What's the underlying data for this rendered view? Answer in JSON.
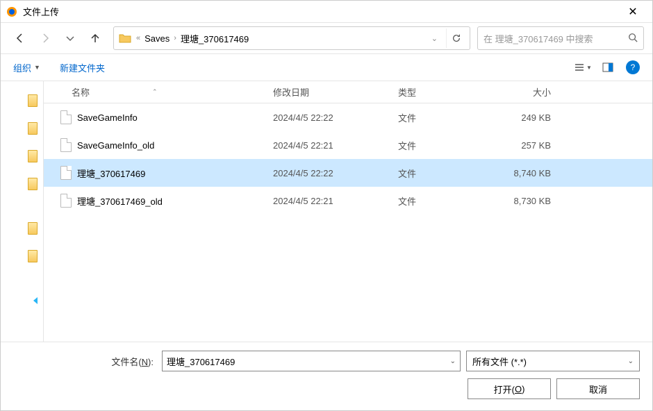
{
  "title": "文件上传",
  "path": {
    "crumbs": [
      "Saves",
      "理塘_370617469"
    ]
  },
  "search": {
    "placeholder": "在 理塘_370617469 中搜索"
  },
  "toolbar": {
    "organize": "组织",
    "new_folder": "新建文件夹"
  },
  "columns": {
    "name": "名称",
    "date": "修改日期",
    "type": "类型",
    "size": "大小"
  },
  "files": [
    {
      "name": "SaveGameInfo",
      "date": "2024/4/5 22:22",
      "type": "文件",
      "size": "249 KB",
      "selected": false
    },
    {
      "name": "SaveGameInfo_old",
      "date": "2024/4/5 22:21",
      "type": "文件",
      "size": "257 KB",
      "selected": false
    },
    {
      "name": "理塘_370617469",
      "date": "2024/4/5 22:22",
      "type": "文件",
      "size": "8,740 KB",
      "selected": true
    },
    {
      "name": "理塘_370617469_old",
      "date": "2024/4/5 22:21",
      "type": "文件",
      "size": "8,730 KB",
      "selected": false
    }
  ],
  "filename": {
    "label_pre": "文件名(",
    "label_key": "N",
    "label_post": "):",
    "value": "理塘_370617469"
  },
  "filter": {
    "value": "所有文件 (*.*)"
  },
  "buttons": {
    "open_pre": "打开(",
    "open_key": "O",
    "open_post": ")",
    "cancel": "取消"
  }
}
